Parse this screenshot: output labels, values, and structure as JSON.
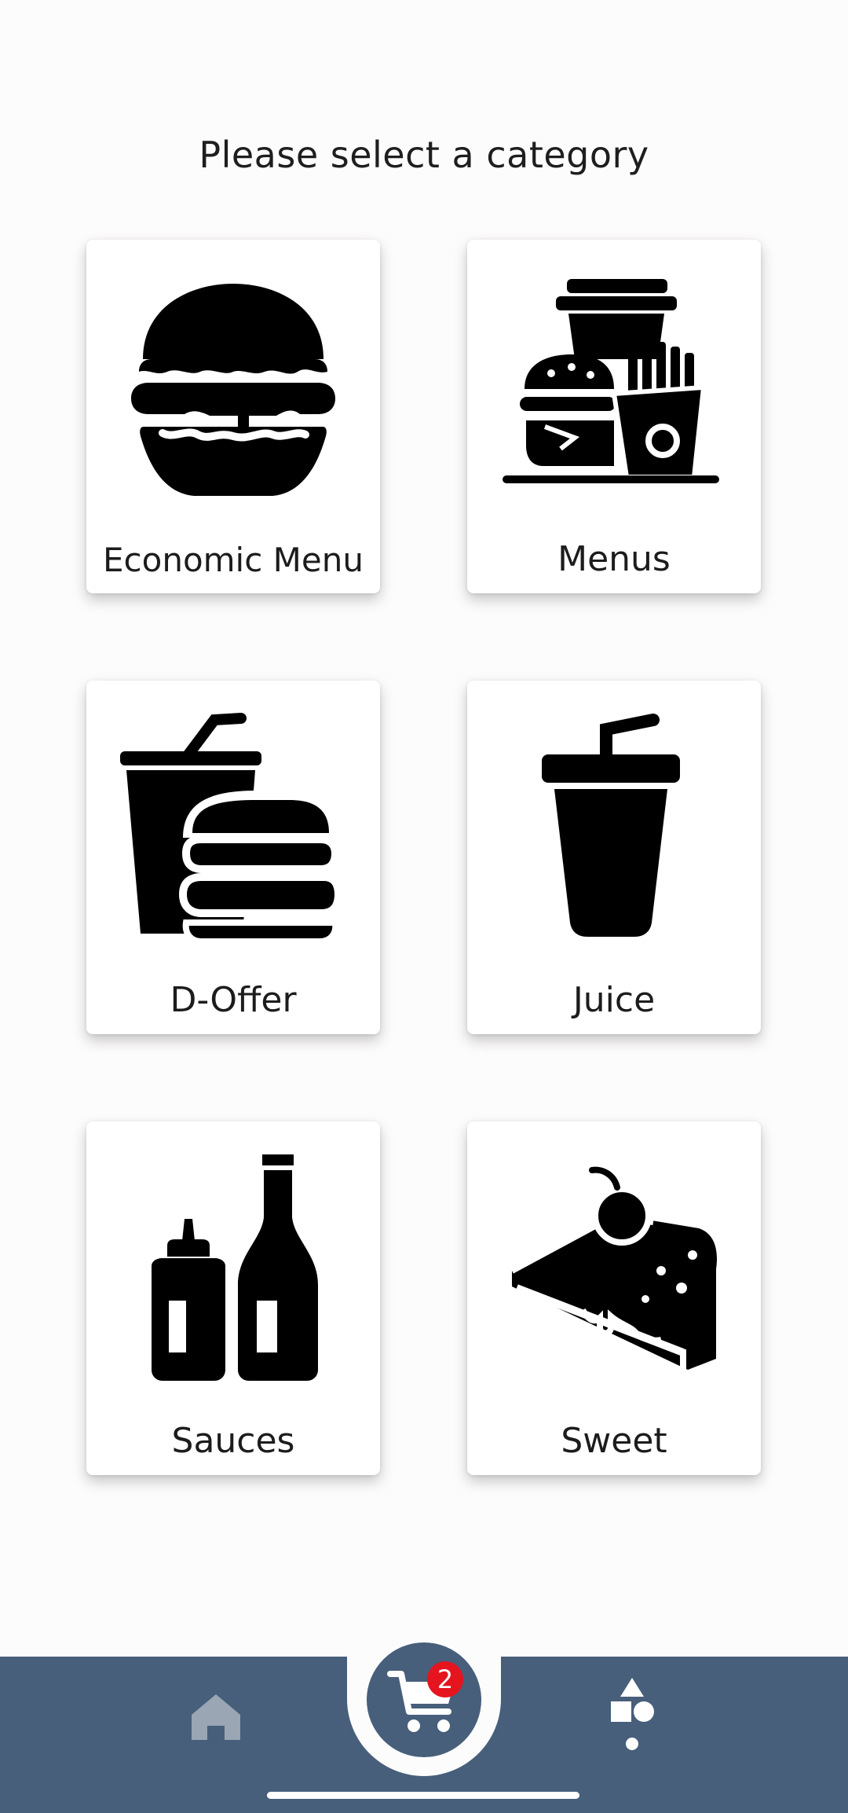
{
  "header": {
    "title": "Please select a category"
  },
  "categories": [
    {
      "label": "Economic Menu",
      "icon": "burger-icon"
    },
    {
      "label": "Menus",
      "icon": "combo-meal-icon"
    },
    {
      "label": "D-Offer",
      "icon": "drink-burger-icon"
    },
    {
      "label": "Juice",
      "icon": "cup-straw-icon"
    },
    {
      "label": "Sauces",
      "icon": "sauce-bottles-icon"
    },
    {
      "label": "Sweet",
      "icon": "cake-slice-icon"
    }
  ],
  "bottom_nav": {
    "items": [
      {
        "icon": "home-icon"
      },
      {
        "icon": "cart-icon",
        "badge": "2"
      },
      {
        "icon": "categories-shapes-icon"
      }
    ]
  },
  "colors": {
    "nav_background": "#475f7b",
    "badge": "#e5141e",
    "page_background": "#fdfcfc",
    "home_icon": "#9aa6b4"
  }
}
